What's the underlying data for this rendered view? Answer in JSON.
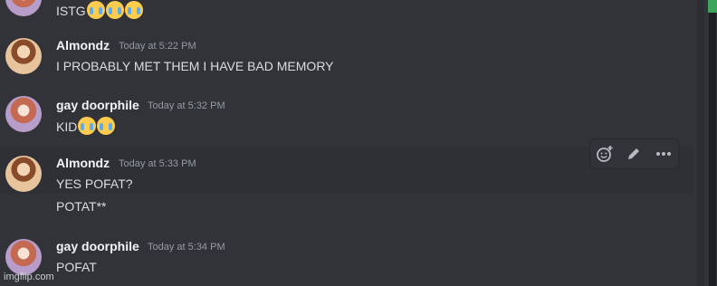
{
  "messages": [
    {
      "author": "",
      "time": "",
      "text": "ISTG",
      "emojis": 3
    },
    {
      "author": "Almondz",
      "time": "Today at 5:22 PM",
      "text": "I PROBABLY MET THEM I HAVE BAD MEMORY"
    },
    {
      "author": "gay doorphile",
      "time": "Today at 5:32 PM",
      "text": "KID",
      "emojis": 2
    },
    {
      "author": "Almondz",
      "time": "Today at 5:33 PM",
      "text": "YES POFAT?",
      "followup": "POTAT**"
    },
    {
      "author": "gay doorphile",
      "time": "Today at 5:34 PM",
      "text": "POFAT"
    }
  ],
  "toolbar": {
    "icons": [
      "add-reaction-icon",
      "edit-icon",
      "more-options-icon"
    ]
  },
  "watermark": "imgflip.com",
  "colors": {
    "background": "#313338",
    "hover_background": "#2e3035",
    "username": "#f2f3f5",
    "timestamp": "#949ba4",
    "text": "#dbdee1",
    "accent_green": "#3ba55c"
  }
}
